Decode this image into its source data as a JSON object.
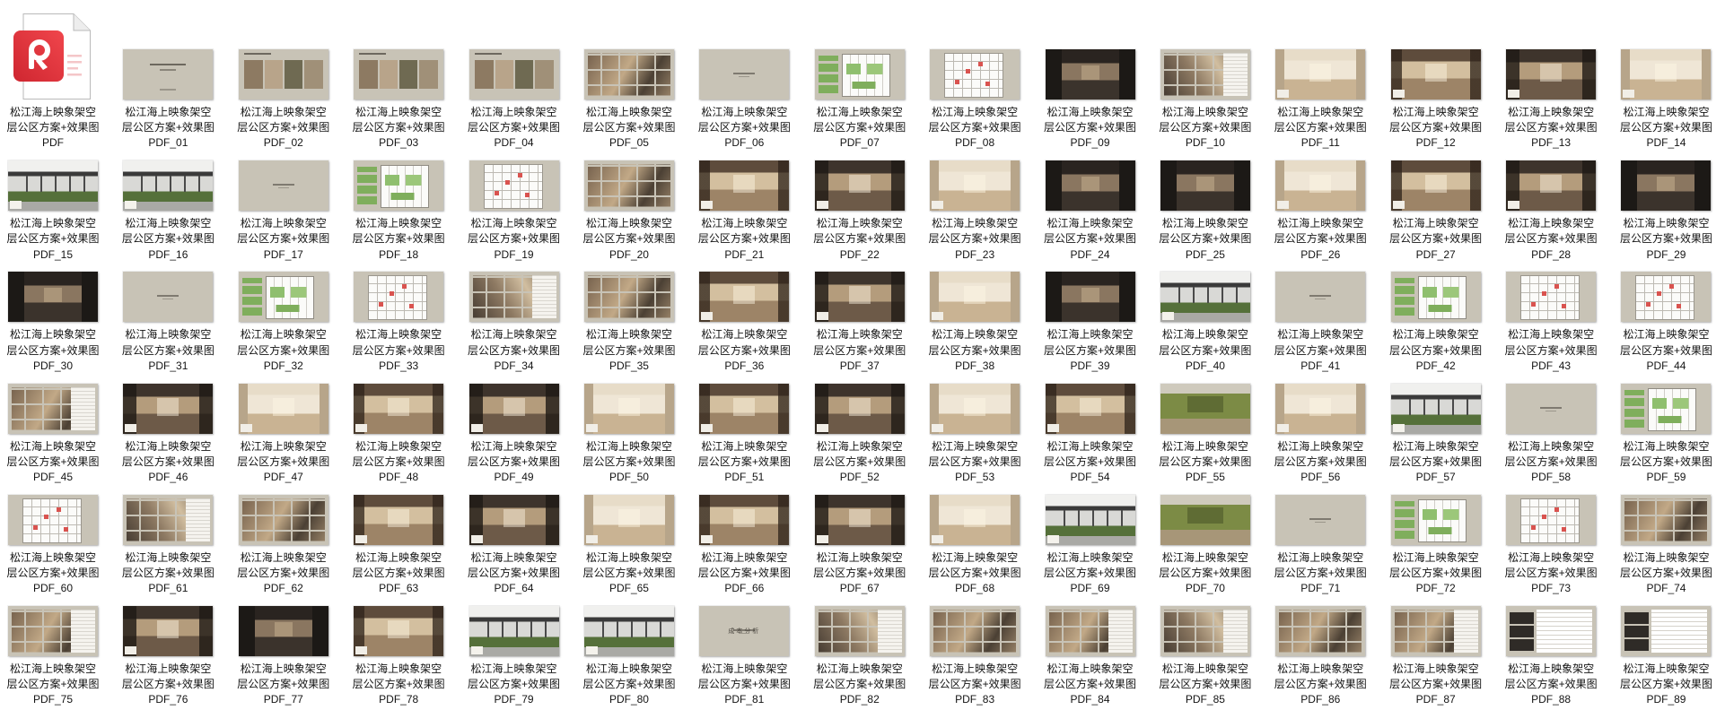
{
  "colors": {
    "thumbnail_background": "#c8c3b6",
    "pdf_icon_red": "#e8323c",
    "label_text": "#141414"
  },
  "files": [
    {
      "lines": [
        "松江海上映象架空",
        "层公区方案+效果图",
        "PDF"
      ],
      "icon": "pdf-file-icon"
    },
    {
      "lines": [
        "松江海上映象架空",
        "层公区方案+效果图",
        "PDF_01"
      ]
    },
    {
      "lines": [
        "松江海上映象架空",
        "层公区方案+效果图",
        "PDF_02"
      ]
    },
    {
      "lines": [
        "松江海上映象架空",
        "层公区方案+效果图",
        "PDF_03"
      ]
    },
    {
      "lines": [
        "松江海上映象架空",
        "层公区方案+效果图",
        "PDF_04"
      ]
    },
    {
      "lines": [
        "松江海上映象架空",
        "层公区方案+效果图",
        "PDF_05"
      ]
    },
    {
      "lines": [
        "松江海上映象架空",
        "层公区方案+效果图",
        "PDF_06"
      ]
    },
    {
      "lines": [
        "松江海上映象架空",
        "层公区方案+效果图",
        "PDF_07"
      ]
    },
    {
      "lines": [
        "松江海上映象架空",
        "层公区方案+效果图",
        "PDF_08"
      ]
    },
    {
      "lines": [
        "松江海上映象架空",
        "层公区方案+效果图",
        "PDF_09"
      ]
    },
    {
      "lines": [
        "松江海上映象架空",
        "层公区方案+效果图",
        "PDF_10"
      ]
    },
    {
      "lines": [
        "松江海上映象架空",
        "层公区方案+效果图",
        "PDF_11"
      ]
    },
    {
      "lines": [
        "松江海上映象架空",
        "层公区方案+效果图",
        "PDF_12"
      ]
    },
    {
      "lines": [
        "松江海上映象架空",
        "层公区方案+效果图",
        "PDF_13"
      ]
    },
    {
      "lines": [
        "松江海上映象架空",
        "层公区方案+效果图",
        "PDF_14"
      ]
    },
    {
      "lines": [
        "松江海上映象架空",
        "层公区方案+效果图",
        "PDF_15"
      ]
    },
    {
      "lines": [
        "松江海上映象架空",
        "层公区方案+效果图",
        "PDF_16"
      ]
    },
    {
      "lines": [
        "松江海上映象架空",
        "层公区方案+效果图",
        "PDF_17"
      ]
    },
    {
      "lines": [
        "松江海上映象架空",
        "层公区方案+效果图",
        "PDF_18"
      ]
    },
    {
      "lines": [
        "松江海上映象架空",
        "层公区方案+效果图",
        "PDF_19"
      ]
    },
    {
      "lines": [
        "松江海上映象架空",
        "层公区方案+效果图",
        "PDF_20"
      ]
    },
    {
      "lines": [
        "松江海上映象架空",
        "层公区方案+效果图",
        "PDF_21"
      ]
    },
    {
      "lines": [
        "松江海上映象架空",
        "层公区方案+效果图",
        "PDF_22"
      ]
    },
    {
      "lines": [
        "松江海上映象架空",
        "层公区方案+效果图",
        "PDF_23"
      ]
    },
    {
      "lines": [
        "松江海上映象架空",
        "层公区方案+效果图",
        "PDF_24"
      ]
    },
    {
      "lines": [
        "松江海上映象架空",
        "层公区方案+效果图",
        "PDF_25"
      ]
    },
    {
      "lines": [
        "松江海上映象架空",
        "层公区方案+效果图",
        "PDF_26"
      ]
    },
    {
      "lines": [
        "松江海上映象架空",
        "层公区方案+效果图",
        "PDF_27"
      ]
    },
    {
      "lines": [
        "松江海上映象架空",
        "层公区方案+效果图",
        "PDF_28"
      ]
    },
    {
      "lines": [
        "松江海上映象架空",
        "层公区方案+效果图",
        "PDF_29"
      ]
    },
    {
      "lines": [
        "松江海上映象架空",
        "层公区方案+效果图",
        "PDF_30"
      ]
    },
    {
      "lines": [
        "松江海上映象架空",
        "层公区方案+效果图",
        "PDF_31"
      ]
    },
    {
      "lines": [
        "松江海上映象架空",
        "层公区方案+效果图",
        "PDF_32"
      ]
    },
    {
      "lines": [
        "松江海上映象架空",
        "层公区方案+效果图",
        "PDF_33"
      ]
    },
    {
      "lines": [
        "松江海上映象架空",
        "层公区方案+效果图",
        "PDF_34"
      ]
    },
    {
      "lines": [
        "松江海上映象架空",
        "层公区方案+效果图",
        "PDF_35"
      ]
    },
    {
      "lines": [
        "松江海上映象架空",
        "层公区方案+效果图",
        "PDF_36"
      ]
    },
    {
      "lines": [
        "松江海上映象架空",
        "层公区方案+效果图",
        "PDF_37"
      ]
    },
    {
      "lines": [
        "松江海上映象架空",
        "层公区方案+效果图",
        "PDF_38"
      ]
    },
    {
      "lines": [
        "松江海上映象架空",
        "层公区方案+效果图",
        "PDF_39"
      ]
    },
    {
      "lines": [
        "松江海上映象架空",
        "层公区方案+效果图",
        "PDF_40"
      ]
    },
    {
      "lines": [
        "松江海上映象架空",
        "层公区方案+效果图",
        "PDF_41"
      ]
    },
    {
      "lines": [
        "松江海上映象架空",
        "层公区方案+效果图",
        "PDF_42"
      ]
    },
    {
      "lines": [
        "松江海上映象架空",
        "层公区方案+效果图",
        "PDF_43"
      ]
    },
    {
      "lines": [
        "松江海上映象架空",
        "层公区方案+效果图",
        "PDF_44"
      ]
    },
    {
      "lines": [
        "松江海上映象架空",
        "层公区方案+效果图",
        "PDF_45"
      ]
    },
    {
      "lines": [
        "松江海上映象架空",
        "层公区方案+效果图",
        "PDF_46"
      ]
    },
    {
      "lines": [
        "松江海上映象架空",
        "层公区方案+效果图",
        "PDF_47"
      ]
    },
    {
      "lines": [
        "松江海上映象架空",
        "层公区方案+效果图",
        "PDF_48"
      ]
    },
    {
      "lines": [
        "松江海上映象架空",
        "层公区方案+效果图",
        "PDF_49"
      ]
    },
    {
      "lines": [
        "松江海上映象架空",
        "层公区方案+效果图",
        "PDF_50"
      ]
    },
    {
      "lines": [
        "松江海上映象架空",
        "层公区方案+效果图",
        "PDF_51"
      ]
    },
    {
      "lines": [
        "松江海上映象架空",
        "层公区方案+效果图",
        "PDF_52"
      ]
    },
    {
      "lines": [
        "松江海上映象架空",
        "层公区方案+效果图",
        "PDF_53"
      ]
    },
    {
      "lines": [
        "松江海上映象架空",
        "层公区方案+效果图",
        "PDF_54"
      ]
    },
    {
      "lines": [
        "松江海上映象架空",
        "层公区方案+效果图",
        "PDF_55"
      ]
    },
    {
      "lines": [
        "松江海上映象架空",
        "层公区方案+效果图",
        "PDF_56"
      ]
    },
    {
      "lines": [
        "松江海上映象架空",
        "层公区方案+效果图",
        "PDF_57"
      ]
    },
    {
      "lines": [
        "松江海上映象架空",
        "层公区方案+效果图",
        "PDF_58"
      ]
    },
    {
      "lines": [
        "松江海上映象架空",
        "层公区方案+效果图",
        "PDF_59"
      ]
    },
    {
      "lines": [
        "松江海上映象架空",
        "层公区方案+效果图",
        "PDF_60"
      ]
    },
    {
      "lines": [
        "松江海上映象架空",
        "层公区方案+效果图",
        "PDF_61"
      ]
    },
    {
      "lines": [
        "松江海上映象架空",
        "层公区方案+效果图",
        "PDF_62"
      ]
    },
    {
      "lines": [
        "松江海上映象架空",
        "层公区方案+效果图",
        "PDF_63"
      ]
    },
    {
      "lines": [
        "松江海上映象架空",
        "层公区方案+效果图",
        "PDF_64"
      ]
    },
    {
      "lines": [
        "松江海上映象架空",
        "层公区方案+效果图",
        "PDF_65"
      ]
    },
    {
      "lines": [
        "松江海上映象架空",
        "层公区方案+效果图",
        "PDF_66"
      ]
    },
    {
      "lines": [
        "松江海上映象架空",
        "层公区方案+效果图",
        "PDF_67"
      ]
    },
    {
      "lines": [
        "松江海上映象架空",
        "层公区方案+效果图",
        "PDF_68"
      ]
    },
    {
      "lines": [
        "松江海上映象架空",
        "层公区方案+效果图",
        "PDF_69"
      ]
    },
    {
      "lines": [
        "松江海上映象架空",
        "层公区方案+效果图",
        "PDF_70"
      ]
    },
    {
      "lines": [
        "松江海上映象架空",
        "层公区方案+效果图",
        "PDF_71"
      ]
    },
    {
      "lines": [
        "松江海上映象架空",
        "层公区方案+效果图",
        "PDF_72"
      ]
    },
    {
      "lines": [
        "松江海上映象架空",
        "层公区方案+效果图",
        "PDF_73"
      ]
    },
    {
      "lines": [
        "松江海上映象架空",
        "层公区方案+效果图",
        "PDF_74"
      ]
    },
    {
      "lines": [
        "松江海上映象架空",
        "层公区方案+效果图",
        "PDF_75"
      ]
    },
    {
      "lines": [
        "松江海上映象架空",
        "层公区方案+效果图",
        "PDF_76"
      ]
    },
    {
      "lines": [
        "松江海上映象架空",
        "层公区方案+效果图",
        "PDF_77"
      ]
    },
    {
      "lines": [
        "松江海上映象架空",
        "层公区方案+效果图",
        "PDF_78"
      ]
    },
    {
      "lines": [
        "松江海上映象架空",
        "层公区方案+效果图",
        "PDF_79"
      ]
    },
    {
      "lines": [
        "松江海上映象架空",
        "层公区方案+效果图",
        "PDF_80"
      ]
    },
    {
      "lines": [
        "松江海上映象架空",
        "层公区方案+效果图",
        "PDF_81"
      ],
      "thumb_text": "成本分析"
    },
    {
      "lines": [
        "松江海上映象架空",
        "层公区方案+效果图",
        "PDF_82"
      ]
    },
    {
      "lines": [
        "松江海上映象架空",
        "层公区方案+效果图",
        "PDF_83"
      ]
    },
    {
      "lines": [
        "松江海上映象架空",
        "层公区方案+效果图",
        "PDF_84"
      ]
    },
    {
      "lines": [
        "松江海上映象架空",
        "层公区方案+效果图",
        "PDF_85"
      ]
    },
    {
      "lines": [
        "松江海上映象架空",
        "层公区方案+效果图",
        "PDF_86"
      ]
    },
    {
      "lines": [
        "松江海上映象架空",
        "层公区方案+效果图",
        "PDF_87"
      ]
    },
    {
      "lines": [
        "松江海上映象架空",
        "层公区方案+效果图",
        "PDF_88"
      ]
    },
    {
      "lines": [
        "松江海上映象架空",
        "层公区方案+效果图",
        "PDF_89"
      ]
    }
  ]
}
